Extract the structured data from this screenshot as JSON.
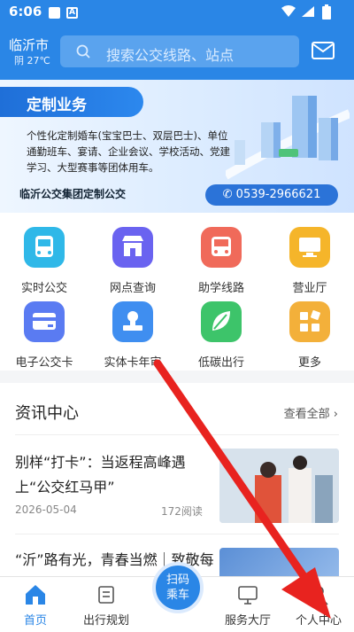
{
  "status_bar": {
    "time": "6:06"
  },
  "header": {
    "city": "临沂市",
    "weather": "阴 27℃",
    "search_placeholder": "搜索公交线路、站点"
  },
  "banner": {
    "title": "定制业务",
    "description": "个性化定制婚车(宝宝巴士、双层巴士)、单位通勤班车、宴请、企业会议、学校活动、党建学习、大型赛事等团体用车。",
    "company": "临沂公交集团定制公交",
    "phone": "0539-2966621"
  },
  "services": [
    {
      "label": "实时公交",
      "icon": "bus-icon",
      "color": "#2fb8e8"
    },
    {
      "label": "网点查询",
      "icon": "store-icon",
      "color": "#6a63f0"
    },
    {
      "label": "助学线路",
      "icon": "school-bus-icon",
      "color": "#f06a5a"
    },
    {
      "label": "营业厅",
      "icon": "monitor-icon",
      "color": "#f5b52a"
    },
    {
      "label": "电子公交卡",
      "icon": "card-icon",
      "color": "#5a7bf2"
    },
    {
      "label": "实体卡年审",
      "icon": "stamp-icon",
      "color": "#3f8ef0"
    },
    {
      "label": "低碳出行",
      "icon": "leaf-icon",
      "color": "#3dc46a"
    },
    {
      "label": "更多",
      "icon": "grid-more-icon",
      "color": "#f3b03a"
    }
  ],
  "news": {
    "section_title": "资讯中心",
    "view_all": "查看全部",
    "items": [
      {
        "title": "别样“打卡”：当返程高峰遇上“公交红马甲”",
        "date": "2026-05-04",
        "reads": "172阅读"
      },
      {
        "title": "“沂”路有光，青春当燃｜致敬每一颗逐梦的心"
      }
    ]
  },
  "tabbar": {
    "home": "首页",
    "trip": "出行规划",
    "scan_line1": "扫码",
    "scan_line2": "乘车",
    "service": "服务大厅",
    "profile": "个人中心"
  }
}
